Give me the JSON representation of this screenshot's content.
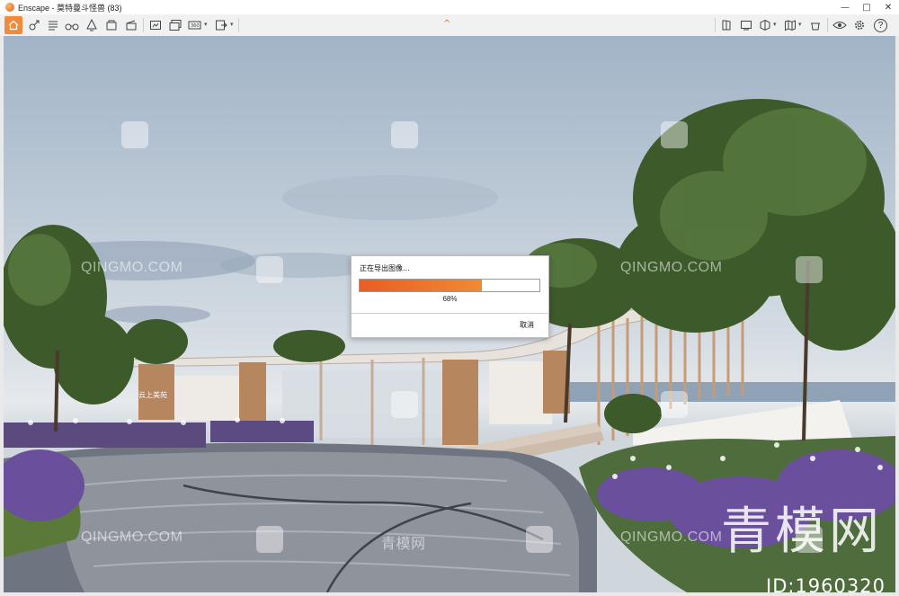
{
  "window": {
    "app_name": "Enscape",
    "title": "Enscape - 莫特曼斗怪兽 (83)",
    "minimize_glyph": "—",
    "maximize_glyph": "□",
    "close_glyph": "✕"
  },
  "toolbar": {
    "icons": [
      "home-icon",
      "pan-icon",
      "text-icon",
      "settings-icon",
      "binoculars-icon",
      "light-icon",
      "views-icon",
      "clapperboard-icon",
      "capture-icon",
      "batch-capture-icon",
      "panorama-icon",
      "export-icon",
      "book-icon",
      "screen-icon",
      "cube-icon",
      "map-icon",
      "assets-icon",
      "visual-settings-icon",
      "gear-icon",
      "help-icon"
    ],
    "help_glyph": "?",
    "collapse_glyph": "^"
  },
  "colors": {
    "accent": "#ef8b3a",
    "progress_start": "#ea5d24",
    "progress_end": "#f18a33"
  },
  "viewport": {
    "watermark_text": "QINGMO.COM",
    "watermark_cn": "青模网",
    "watermark_big": "青模网",
    "watermark_id": "ID:1960320",
    "sign_text": "云上美苑"
  },
  "dialog": {
    "title": "正在导出图像...",
    "progress": 0.68,
    "percent_label": "68%",
    "cancel_label": "取消"
  }
}
